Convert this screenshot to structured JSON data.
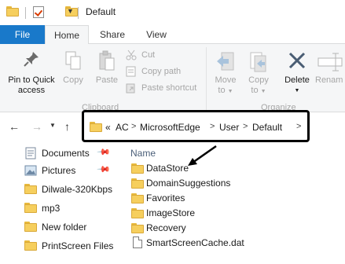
{
  "title": {
    "text": "Default"
  },
  "tabs": [
    {
      "label": "File"
    },
    {
      "label": "Home"
    },
    {
      "label": "Share"
    },
    {
      "label": "View"
    }
  ],
  "ribbon": {
    "pin_label_line1": "Pin to Quick",
    "pin_label_line2": "access",
    "copy_label": "Copy",
    "paste_label": "Paste",
    "cut_label": "Cut",
    "copy_path_label": "Copy path",
    "paste_shortcut_label": "Paste shortcut",
    "clipboard_group": "Clipboard",
    "move_to_line1": "Move",
    "move_to_line2": "to",
    "copy_to_line1": "Copy",
    "copy_to_line2": "to",
    "delete_label": "Delete",
    "rename_label": "Renam",
    "organize_group": "Organize"
  },
  "address": {
    "overflow": "«",
    "crumbs": [
      "AC",
      "MicrosoftEdge",
      "User",
      "Default"
    ]
  },
  "nav_pane": {
    "items": [
      {
        "label": "Documents",
        "icon": "documents-icon",
        "pinned": true
      },
      {
        "label": "Pictures",
        "icon": "pictures-icon",
        "pinned": true
      },
      {
        "label": "Dilwale-320Kbps",
        "icon": "folder-icon",
        "pinned": false
      },
      {
        "label": "mp3",
        "icon": "folder-icon",
        "pinned": false
      },
      {
        "label": "New folder",
        "icon": "folder-icon",
        "pinned": false
      },
      {
        "label": "PrintScreen Files",
        "icon": "folder-icon",
        "pinned": false
      }
    ]
  },
  "file_list": {
    "column_name": "Name",
    "items": [
      {
        "name": "DataStore",
        "type": "folder"
      },
      {
        "name": "DomainSuggestions",
        "type": "folder"
      },
      {
        "name": "Favorites",
        "type": "folder"
      },
      {
        "name": "ImageStore",
        "type": "folder"
      },
      {
        "name": "Recovery",
        "type": "folder"
      },
      {
        "name": "SmartScreenCache.dat",
        "type": "file"
      }
    ]
  },
  "colors": {
    "file_tab": "#1979ca",
    "folder": "#f6cf5e",
    "highlight_border": "#000000"
  }
}
